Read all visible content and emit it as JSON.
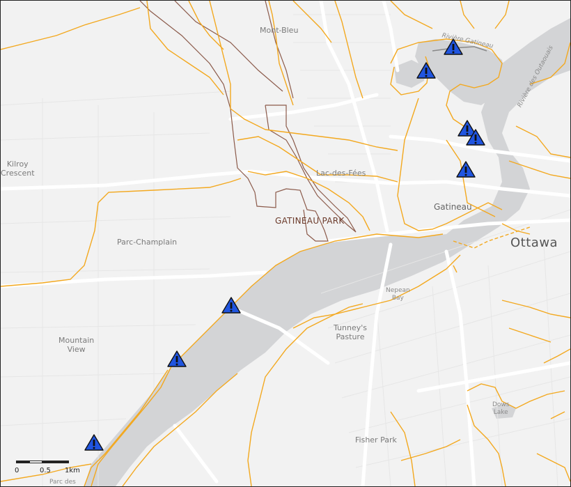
{
  "map": {
    "colors": {
      "land": "#f2f2f2",
      "water": "#d3d4d6",
      "trail": "#f3a81e",
      "road": "#ffffff",
      "park_boundary": "#8b5a4a",
      "marker_fill": "#2055e0"
    },
    "labels": {
      "mont_bleu": "Mont-Bleu",
      "kilroy": "Kilroy\nCrescent",
      "lac_des_fees": "Lac-des-Fées",
      "gatineau_park": "GATINEAU PARK",
      "gatineau": "Gatineau",
      "parc_champlain": "Parc-Champlain",
      "ottawa": "Ottawa",
      "nepean_bay": "Nepean\nBay",
      "tunneys_pasture": "Tunney's\nPasture",
      "mountain_view": "Mountain\nView",
      "dows_lake": "Dows\nLake",
      "fisher_park": "Fisher Park",
      "parc_des": "Parc des",
      "riviere_gatineau": "Rivière Gatineau",
      "riviere_des_outaouais": "Rivière des Outaouais"
    },
    "markers": [
      {
        "name": "hazard-1",
        "icon": "warning-triangle-icon"
      },
      {
        "name": "hazard-2",
        "icon": "warning-triangle-icon"
      },
      {
        "name": "hazard-3",
        "icon": "warning-triangle-icon"
      },
      {
        "name": "hazard-4",
        "icon": "warning-triangle-icon"
      },
      {
        "name": "hazard-5",
        "icon": "warning-triangle-icon"
      },
      {
        "name": "hazard-6",
        "icon": "warning-triangle-icon"
      },
      {
        "name": "hazard-7",
        "icon": "warning-triangle-icon"
      },
      {
        "name": "hazard-8",
        "icon": "warning-triangle-icon"
      },
      {
        "name": "hazard-9",
        "icon": "warning-triangle-icon"
      }
    ],
    "scale_bar": {
      "label_0": "0",
      "label_half": "0.5",
      "label_1": "1km"
    }
  }
}
